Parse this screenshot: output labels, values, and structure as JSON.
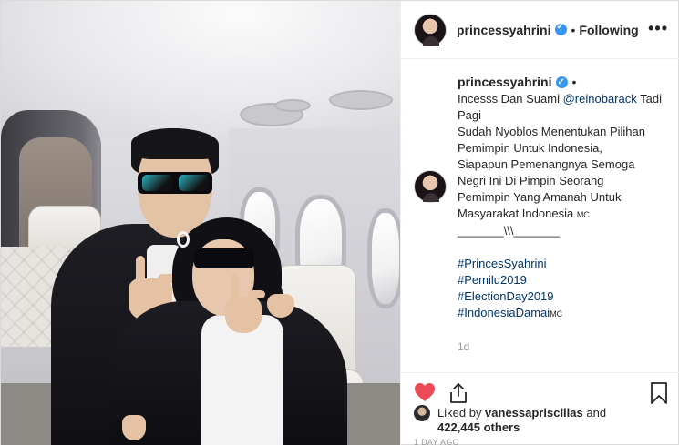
{
  "post": {
    "photo_alt": "",
    "header": {
      "username": "princessyahrini",
      "verified": true,
      "separator": "•",
      "follow_status": "Following",
      "more_icon": "more-horizontal-icon"
    },
    "caption": {
      "username": "princessyahrini",
      "lines": [
        "Incesss Dan Suami ",
        "Pagi",
        "Sudah Nyoblos Menentukan Pilihan",
        "Pemimpin Untuk Indonesia,",
        "Siapapun Pemenangnya Semoga",
        "Negri Ini Di Pimpin Seorang",
        "Pemimpin Yang Amanah Untuk",
        "Masyarakat Indonesia",
        "_______\\\\\\_______"
      ],
      "mention": "@reinobarack",
      "mention_suffix": " Tadi",
      "line8_suffix": "MC",
      "hashtags": [
        "#PrincesSyahrini",
        "#Pemilu2019",
        "#ElectionDay2019",
        "#IndonesiaDamai"
      ],
      "hashtag4_suffix": "MC",
      "time_ago": "1d"
    },
    "actions": {
      "like_icon": "heart-filled-icon",
      "share_icon": "share-upload-icon",
      "save_icon": "bookmark-icon",
      "like_color": "#ed4956"
    },
    "likes": {
      "prefix": "Liked by ",
      "user": "vanessapriscillas",
      "middle": " and",
      "count": "422,445",
      "suffix": " others"
    },
    "timestamp": "1 DAY AGO"
  }
}
